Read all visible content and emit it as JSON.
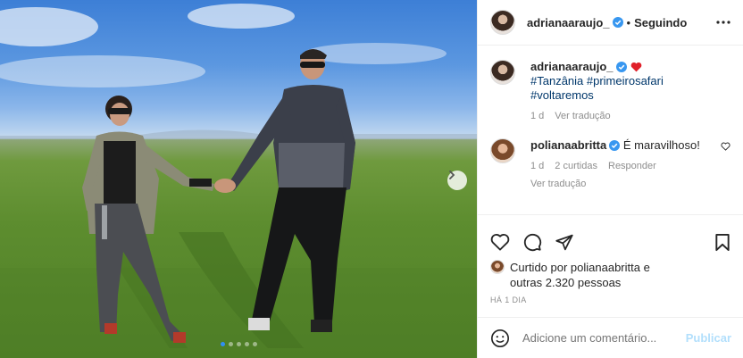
{
  "post": {
    "author": "adrianaaraujo_",
    "follow_bullet": "•",
    "follow_status": "Seguindo"
  },
  "caption": {
    "author": "adrianaaraujo_",
    "hashtag_line1": "#Tanzânia #primeirosafari",
    "hashtag_line2": "#voltaremos",
    "time": "1 d",
    "translate": "Ver tradução"
  },
  "comment": {
    "author": "polianaabritta",
    "text": "É maravilhoso!",
    "time": "1 d",
    "likes": "2 curtidas",
    "reply": "Responder",
    "translate": "Ver tradução"
  },
  "likes": {
    "line1": "Curtido por polianaabritta e",
    "line2": "outras 2.320 pessoas"
  },
  "date": "HÁ 1 DIA",
  "add_comment": {
    "placeholder": "Adicione um comentário...",
    "publish_label": "Publicar"
  },
  "carousel": {
    "slide_count": 5,
    "active_index": 0
  },
  "colors": {
    "verified": "#3897f0",
    "heart": "#ed4956",
    "link": "#00376b",
    "publish": "#b2dffc"
  },
  "icons": [
    "more-options-icon",
    "verified-icon",
    "heart-icon",
    "comment-icon",
    "share-icon",
    "bookmark-icon",
    "emoji-icon",
    "chevron-right-icon"
  ]
}
